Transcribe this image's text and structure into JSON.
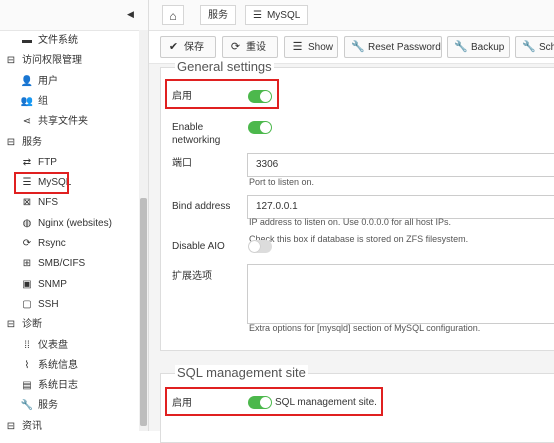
{
  "sidebar": {
    "items": [
      {
        "label": "文件系统",
        "icon": "folder-icon",
        "glyph": "▬",
        "kind": "item"
      },
      {
        "label": "访问权限管理",
        "icon": "minus-square-icon",
        "glyph": "⊟",
        "kind": "sect"
      },
      {
        "label": "用户",
        "icon": "user-icon",
        "glyph": "👤",
        "kind": "item"
      },
      {
        "label": "组",
        "icon": "group-icon",
        "glyph": "👥",
        "kind": "item"
      },
      {
        "label": "共享文件夹",
        "icon": "share-icon",
        "glyph": "⋖",
        "kind": "item"
      },
      {
        "label": "服务",
        "icon": "minus-square-icon",
        "glyph": "⊟",
        "kind": "sect"
      },
      {
        "label": "FTP",
        "icon": "ftp-icon",
        "glyph": "⇄",
        "kind": "item"
      },
      {
        "label": "MySQL",
        "icon": "database-icon",
        "glyph": "☰",
        "kind": "item"
      },
      {
        "label": "NFS",
        "icon": "nfs-icon",
        "glyph": "⊠",
        "kind": "item"
      },
      {
        "label": "Nginx (websites)",
        "icon": "globe-icon",
        "glyph": "◍",
        "kind": "item"
      },
      {
        "label": "Rsync",
        "icon": "rsync-icon",
        "glyph": "⟳",
        "kind": "item"
      },
      {
        "label": "SMB/CIFS",
        "icon": "windows-icon",
        "glyph": "⊞",
        "kind": "item"
      },
      {
        "label": "SNMP",
        "icon": "snmp-icon",
        "glyph": "▣",
        "kind": "item"
      },
      {
        "label": "SSH",
        "icon": "terminal-icon",
        "glyph": "▢",
        "kind": "item"
      },
      {
        "label": "诊断",
        "icon": "minus-square-icon",
        "glyph": "⊟",
        "kind": "sect"
      },
      {
        "label": "仪表盘",
        "icon": "dashboard-icon",
        "glyph": "⁞⁞",
        "kind": "item"
      },
      {
        "label": "系统信息",
        "icon": "chart-icon",
        "glyph": "⌇",
        "kind": "item"
      },
      {
        "label": "系统日志",
        "icon": "log-icon",
        "glyph": "▤",
        "kind": "item"
      },
      {
        "label": "服务",
        "icon": "wrench-icon",
        "glyph": "🔧",
        "kind": "item"
      },
      {
        "label": "资讯",
        "icon": "minus-square-icon",
        "glyph": "⊟",
        "kind": "sect"
      }
    ]
  },
  "breadcrumb": {
    "home_icon": "home-icon",
    "items": [
      "服务",
      "MySQL"
    ]
  },
  "toolbar": {
    "buttons": [
      {
        "label": "保存",
        "icon": "check-icon",
        "glyph": "✔"
      },
      {
        "label": "重设",
        "icon": "refresh-icon",
        "glyph": "⟳"
      },
      {
        "label": "Show",
        "icon": "database-icon",
        "glyph": "☰"
      },
      {
        "label": "Reset Password",
        "icon": "wrench-icon",
        "glyph": "🔧"
      },
      {
        "label": "Backup",
        "icon": "wrench-icon",
        "glyph": "🔧"
      },
      {
        "label": "Sch",
        "icon": "wrench-icon",
        "glyph": "🔧"
      }
    ]
  },
  "general": {
    "legend": "General settings",
    "enable_label": "启用",
    "enable_on": true,
    "networking_label_1": "Enable",
    "networking_label_2": "networking",
    "networking_on": true,
    "port_label": "端口",
    "port_value": "3306",
    "port_hint": "Port to listen on.",
    "bind_label": "Bind address",
    "bind_value": "127.0.0.1",
    "bind_hint": "IP address to listen on. Use 0.0.0.0 for all host IPs.",
    "aio_label": "Disable AIO",
    "aio_on": false,
    "aio_hint": "Check this box if database is stored on ZFS filesystem.",
    "extra_label": "扩展选项",
    "extra_value": "",
    "extra_hint": "Extra options for [mysqld] section of MySQL configuration."
  },
  "sqlsite": {
    "legend": "SQL management site",
    "enable_label": "启用",
    "enable_on": true,
    "enable_hint": "SQL management site."
  },
  "colors": {
    "toggle_on": "#4cb84c",
    "highlight": "#e02020"
  }
}
